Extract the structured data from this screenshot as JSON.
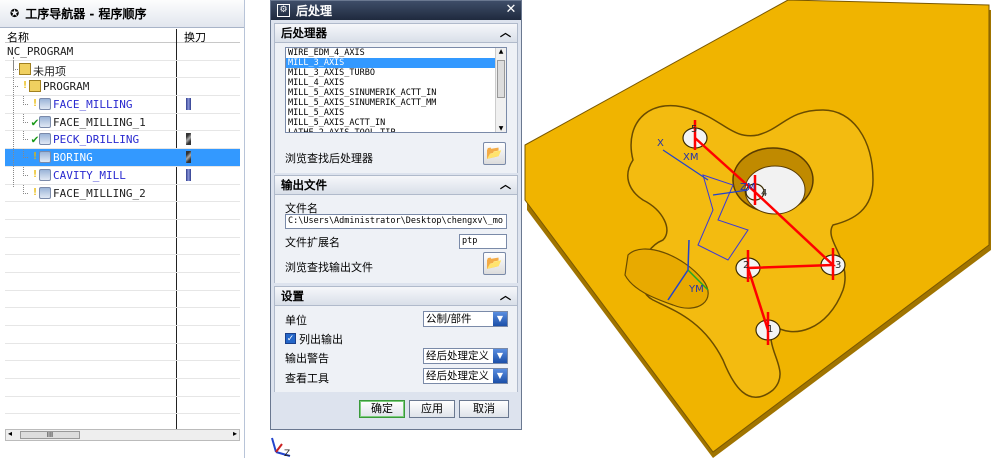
{
  "navigator": {
    "title": "工序导航器 - 程序顺序",
    "columns": {
      "name": "名称",
      "tool": "换刀"
    },
    "root": "NC_PROGRAM",
    "rows": [
      {
        "label": "未用项",
        "indent": 1,
        "icon": "unused-group-icon",
        "status": "",
        "link": false,
        "tool": ""
      },
      {
        "label": "PROGRAM",
        "indent": 1,
        "icon": "program-group-icon",
        "status": "flag",
        "link": false,
        "tool": ""
      },
      {
        "label": "FACE_MILLING",
        "indent": 2,
        "icon": "face-milling-op-icon",
        "status": "flag",
        "link": true,
        "tool": "mill"
      },
      {
        "label": "FACE_MILLING_1",
        "indent": 2,
        "icon": "face-milling-op-icon",
        "status": "check",
        "link": false,
        "tool": ""
      },
      {
        "label": "PECK_DRILLING",
        "indent": 2,
        "icon": "drilling-op-icon",
        "status": "check",
        "link": true,
        "tool": "drill"
      },
      {
        "label": "BORING",
        "indent": 2,
        "icon": "boring-op-icon",
        "status": "flag",
        "link": true,
        "tool": "drill",
        "selected": true
      },
      {
        "label": "CAVITY_MILL",
        "indent": 2,
        "icon": "cavity-mill-op-icon",
        "status": "flag",
        "link": true,
        "tool": "mill"
      },
      {
        "label": "FACE_MILLING_2",
        "indent": 2,
        "icon": "face-milling-op-icon",
        "status": "flag",
        "link": false,
        "tool": ""
      }
    ],
    "scroll_label": "III"
  },
  "dialog": {
    "title": "后处理",
    "postprocessor": {
      "header": "后处理器",
      "items": [
        "WIRE_EDM_4_AXIS",
        "MILL_3_AXIS",
        "MILL_3_AXIS_TURBO",
        "MILL_4_AXIS",
        "MILL_5_AXIS_SINUMERIK_ACTT_IN",
        "MILL_5_AXIS_SINUMERIK_ACTT_MM",
        "MILL_5_AXIS",
        "MILL_5_AXIS_ACTT_IN",
        "LATHE_2_AXIS_TOOL_TIP"
      ],
      "selected": "MILL_3_AXIS",
      "browse_label": "浏览查找后处理器"
    },
    "output": {
      "header": "输出文件",
      "filename_label": "文件名",
      "filename_value": "C:\\Users\\Administrator\\Desktop\\chengxv\\_mo",
      "ext_label": "文件扩展名",
      "ext_value": "ptp",
      "browse_label": "浏览查找输出文件"
    },
    "settings": {
      "header": "设置",
      "unit_label": "单位",
      "unit_value": "公制/部件",
      "list_output_label": "列出输出",
      "list_output_checked": true,
      "warning_label": "输出警告",
      "warning_value": "经后处理定义",
      "review_label": "查看工具",
      "review_value": "经后处理定义"
    },
    "buttons": {
      "ok": "确定",
      "apply": "应用",
      "cancel": "取消"
    }
  },
  "viewport": {
    "part_color": "#f0b400",
    "toolpath_color": "#ff0000",
    "hole_labels": [
      "5",
      "4",
      "3",
      "2",
      "1"
    ],
    "axis_labels": {
      "xm": "XM",
      "ym": "YM",
      "zm": "ZM",
      "x": "X",
      "z": "Z"
    }
  },
  "colors": {
    "selection": "#3399ff",
    "dialog_title": "#2a364e"
  }
}
